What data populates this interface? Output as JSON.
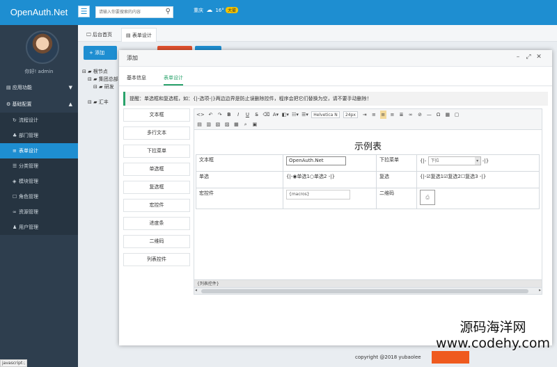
{
  "app": {
    "brand": "OpenAuth.Net",
    "menu_icon": "hamburger-icon"
  },
  "topbar": {
    "search_placeholder": "请输入你要搜索的内容",
    "city": "重庆",
    "temperature": "16°",
    "weather_badge": "大雾"
  },
  "sidebar": {
    "welcome": "你好! admin",
    "groups": [
      {
        "label": "应用功能"
      },
      {
        "label": "基础配置"
      }
    ],
    "items": [
      {
        "label": "流程设计",
        "icon": "flow-icon"
      },
      {
        "label": "部门管理",
        "icon": "org-icon"
      },
      {
        "label": "表单设计",
        "icon": "form-icon",
        "active": true
      },
      {
        "label": "分类管理",
        "icon": "category-icon"
      },
      {
        "label": "模块管理",
        "icon": "module-icon"
      },
      {
        "label": "角色管理",
        "icon": "role-icon"
      },
      {
        "label": "资源管理",
        "icon": "link-icon"
      },
      {
        "label": "用户管理",
        "icon": "user-icon"
      }
    ]
  },
  "status_bar": {
    "text": "javascript:;"
  },
  "tabs": [
    {
      "label": "后台首页"
    },
    {
      "label": "表单设计"
    }
  ],
  "background": {
    "add_button": "+ 添加",
    "tree": [
      "根节点",
      "集团总部",
      "研发",
      "汇丰"
    ],
    "footer": "copyright @2018 yubaolee"
  },
  "modal": {
    "title": "添加",
    "tabs": [
      {
        "label": "基本信息"
      },
      {
        "label": "表单设计"
      }
    ],
    "tip": "提醒：单选框和复选框，如：{|-选项-|}两边边界是防止误删除控件，程序会把它们替换为空，请不要手动删除！",
    "widgets": [
      "文本框",
      "多行文本",
      "下拉菜单",
      "单选框",
      "复选框",
      "宏控件",
      "进度条",
      "二维码",
      "列表控件"
    ],
    "toolbar": {
      "font": "Helvetica N",
      "size": "24px"
    },
    "form": {
      "title": "示例表",
      "rows": [
        {
          "label1": "文本框",
          "value1": "OpenAuth.Net",
          "label2": "下拉菜单",
          "value2": "下拉"
        },
        {
          "label1": "单选",
          "radio": [
            "单选1",
            "单选2"
          ],
          "label2": "复选",
          "checks": [
            "复选1",
            "复选2",
            "复选3"
          ]
        },
        {
          "label1": "宏控件",
          "macro": "{macros}",
          "label2": "二维码"
        }
      ],
      "list_label": "{列表控件}"
    }
  },
  "watermark": {
    "line1": "源码海洋网",
    "line2": "www.codehy.com"
  }
}
